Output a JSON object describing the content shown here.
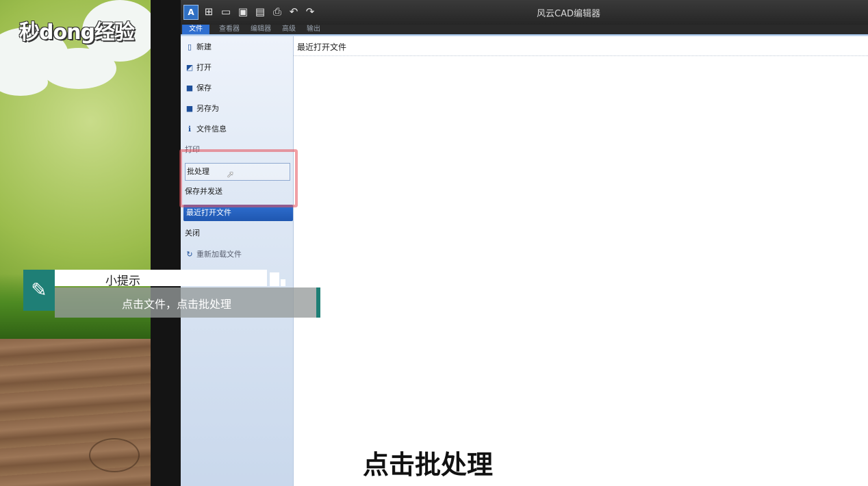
{
  "logo": {
    "text": "秒dong经验"
  },
  "window": {
    "title": "风云CAD编辑器",
    "app_icon": "cad-app-icon",
    "toolbar_icons": [
      "new-icon",
      "open-folder-icon",
      "save-icon",
      "save-as-icon",
      "print-icon",
      "undo-icon",
      "redo-icon"
    ]
  },
  "ribbon": {
    "tabs": [
      {
        "label": "文件",
        "active": true
      },
      {
        "label": "查看器"
      },
      {
        "label": "编辑器"
      },
      {
        "label": "高级"
      },
      {
        "label": "输出"
      }
    ]
  },
  "sidebar": {
    "items": [
      {
        "label": "新建",
        "icon": "new-file-icon"
      },
      {
        "label": "打开",
        "icon": "open-icon"
      },
      {
        "label": "保存",
        "icon": "save-icon"
      },
      {
        "label": "另存为",
        "icon": "save-as-icon"
      },
      {
        "label": "文件信息",
        "icon": "file-info-icon"
      },
      {
        "label": "打印"
      },
      {
        "label": "批处理",
        "state": "hover"
      },
      {
        "label": "保存并发送"
      },
      {
        "label": "最近打开文件",
        "state": "selected"
      },
      {
        "label": "关闭"
      },
      {
        "label": "重新加载文件",
        "icon": "reload-icon"
      }
    ]
  },
  "content": {
    "heading": "最近打开文件"
  },
  "tip": {
    "title": "小提示",
    "body": "点击文件，点击批处理",
    "icon": "lightbulb-icon",
    "accent_color": "#1f7f76"
  },
  "caption": "点击批处理",
  "colors": {
    "accent": "#2f6fd0",
    "highlight": "#e6505a"
  }
}
